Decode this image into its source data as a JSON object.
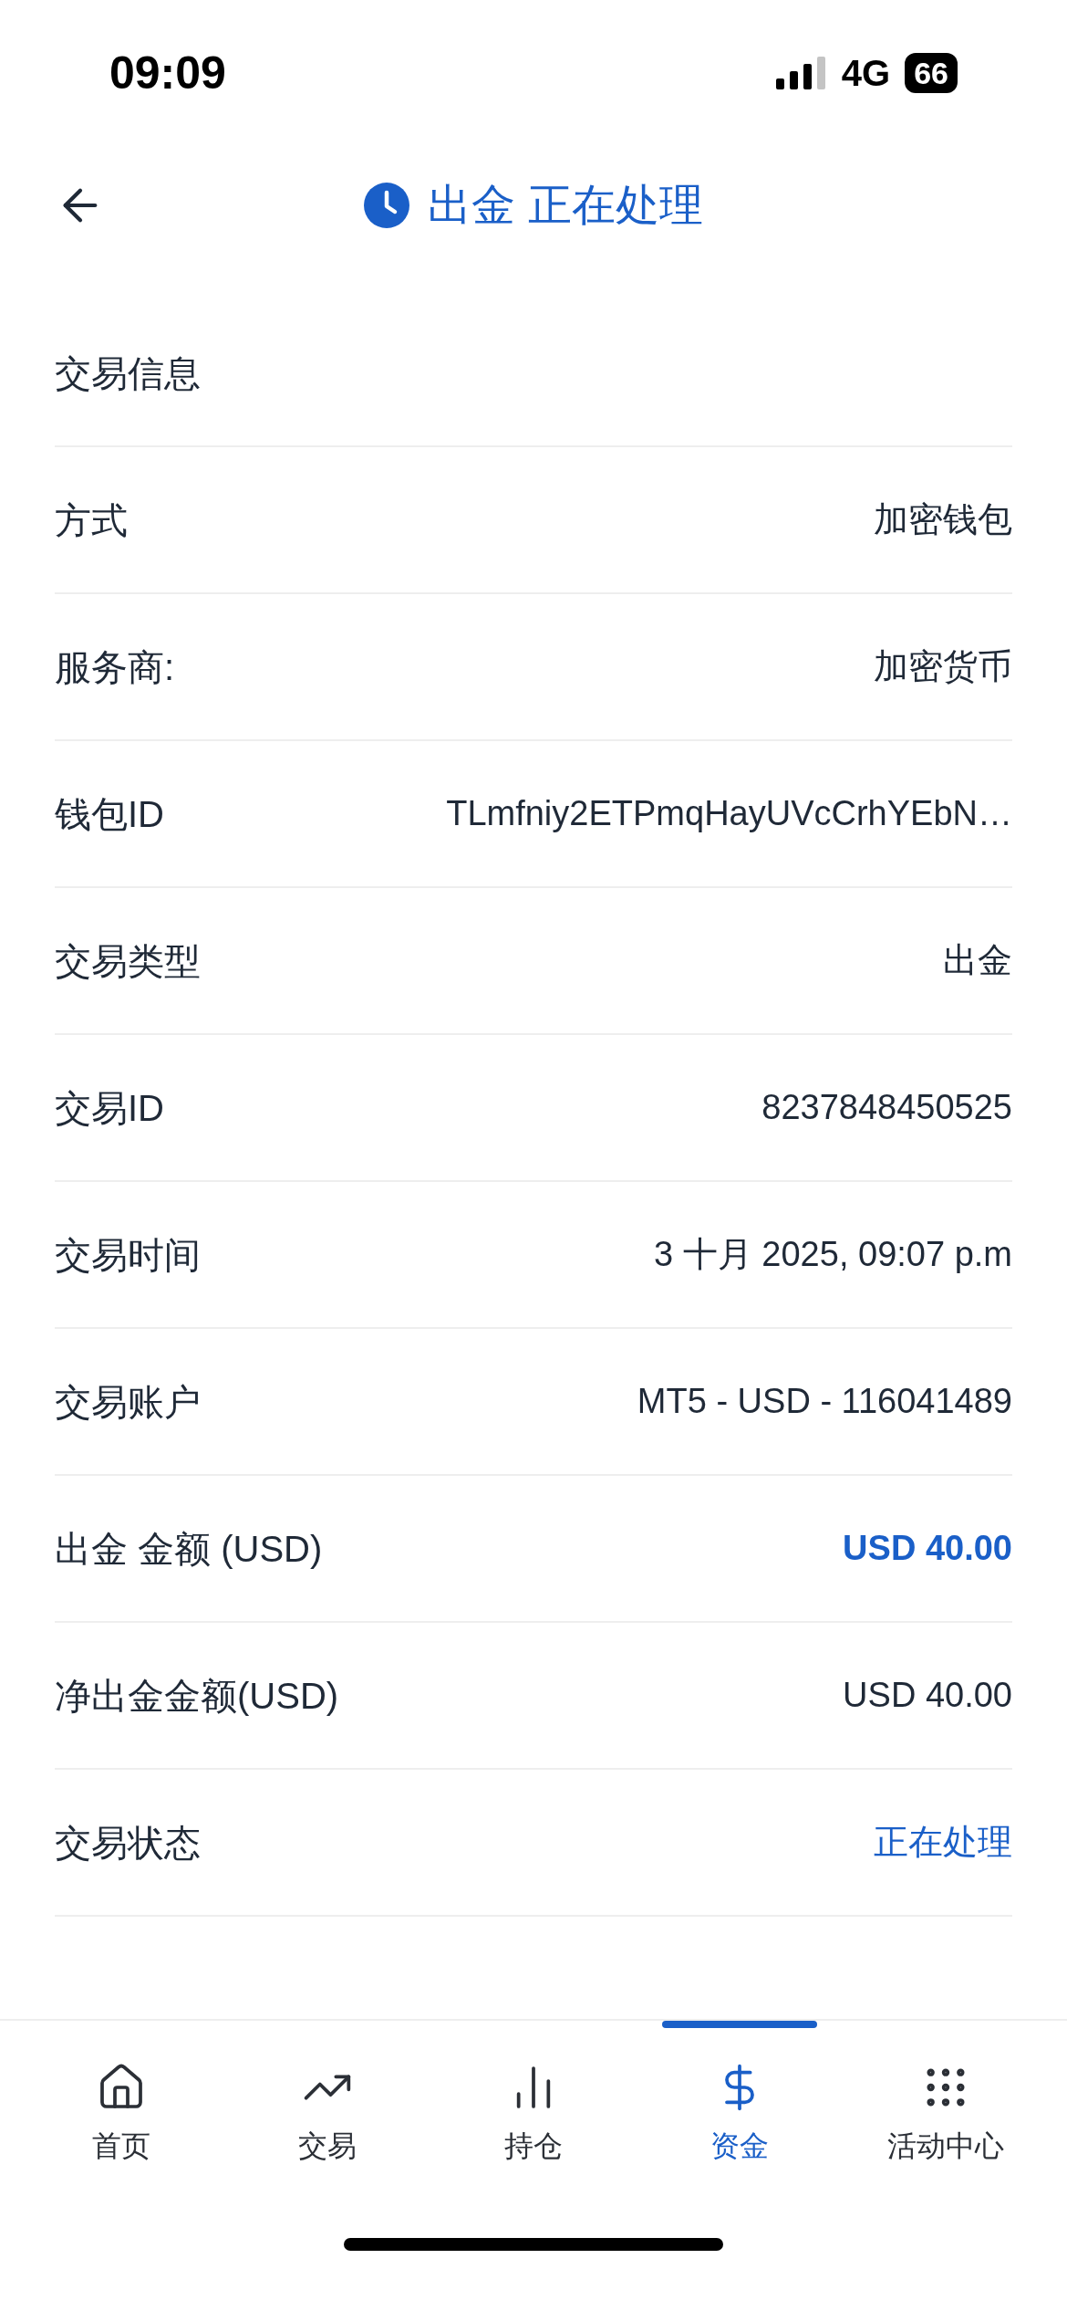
{
  "status_bar": {
    "time": "09:09",
    "network": "4G",
    "battery": "66"
  },
  "header": {
    "title": "出金 正在处理"
  },
  "section_title": "交易信息",
  "rows": [
    {
      "label": "方式",
      "value": "加密钱包",
      "kind": "plain"
    },
    {
      "label": "服务商:",
      "value": "加密货币",
      "kind": "plain"
    },
    {
      "label": "钱包ID",
      "value": "TLmfniy2ETPmqHayUVcCrhYEbN…",
      "kind": "plain"
    },
    {
      "label": "交易类型",
      "value": "出金",
      "kind": "plain"
    },
    {
      "label": "交易ID",
      "value": "8237848450525",
      "kind": "plain"
    },
    {
      "label": "交易时间",
      "value": "3 十月 2025, 09:07 p.m",
      "kind": "plain"
    },
    {
      "label": "交易账户",
      "value": "MT5 - USD - 116041489",
      "kind": "plain"
    },
    {
      "label": "出金 金额 (USD)",
      "value": "USD 40.00",
      "kind": "amount"
    },
    {
      "label": "净出金金额(USD)",
      "value": "USD 40.00",
      "kind": "plain"
    },
    {
      "label": "交易状态",
      "value": "正在处理",
      "kind": "status"
    }
  ],
  "nav": [
    {
      "label": "首页",
      "kind": "home",
      "selected": false
    },
    {
      "label": "交易",
      "kind": "trend",
      "selected": false
    },
    {
      "label": "持仓",
      "kind": "bars",
      "selected": false
    },
    {
      "label": "资金",
      "kind": "dollar",
      "selected": true
    },
    {
      "label": "活动中心",
      "kind": "grid",
      "selected": false
    }
  ]
}
